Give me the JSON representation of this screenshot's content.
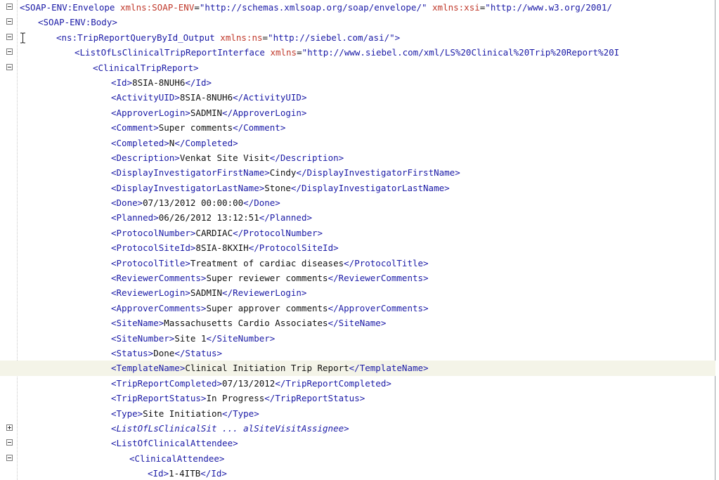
{
  "editor": {
    "lines": [
      {
        "indent": 0,
        "fold": "minus",
        "segs": [
          {
            "k": "tag",
            "t": "<SOAP-ENV:Envelope "
          },
          {
            "k": "attr",
            "t": "xmlns:SOAP-ENV"
          },
          {
            "k": "txt",
            "t": "="
          },
          {
            "k": "val",
            "t": "\"http://schemas.xmlsoap.org/soap/envelope/\" "
          },
          {
            "k": "attr",
            "t": "xmlns:xsi"
          },
          {
            "k": "txt",
            "t": "="
          },
          {
            "k": "val",
            "t": "\"http://www.w3.org/2001/"
          }
        ]
      },
      {
        "indent": 1,
        "fold": "minus",
        "segs": [
          {
            "k": "tag",
            "t": "<SOAP-ENV:Body>"
          }
        ]
      },
      {
        "indent": 2,
        "fold": "minus",
        "cursor": true,
        "segs": [
          {
            "k": "tag",
            "t": "<ns:TripReportQueryById_Output "
          },
          {
            "k": "attr",
            "t": "xmlns:ns"
          },
          {
            "k": "txt",
            "t": "="
          },
          {
            "k": "val",
            "t": "\"http://siebel.com/asi/\">"
          }
        ]
      },
      {
        "indent": 3,
        "fold": "minus",
        "segs": [
          {
            "k": "tag",
            "t": "<ListOfLsClinicalTripReportInterface "
          },
          {
            "k": "attr",
            "t": "xmlns"
          },
          {
            "k": "txt",
            "t": "="
          },
          {
            "k": "val",
            "t": "\"http://www.siebel.com/xml/LS%20Clinical%20Trip%20Report%20I"
          }
        ]
      },
      {
        "indent": 4,
        "fold": "minus",
        "segs": [
          {
            "k": "tag",
            "t": "<ClinicalTripReport>"
          }
        ]
      },
      {
        "indent": 5,
        "segs": [
          {
            "k": "tag",
            "t": "<Id>"
          },
          {
            "k": "txt",
            "t": "8SIA-8NUH6"
          },
          {
            "k": "tag",
            "t": "</Id>"
          }
        ]
      },
      {
        "indent": 5,
        "segs": [
          {
            "k": "tag",
            "t": "<ActivityUID>"
          },
          {
            "k": "txt",
            "t": "8SIA-8NUH6"
          },
          {
            "k": "tag",
            "t": "</ActivityUID>"
          }
        ]
      },
      {
        "indent": 5,
        "segs": [
          {
            "k": "tag",
            "t": "<ApproverLogin>"
          },
          {
            "k": "txt",
            "t": "SADMIN"
          },
          {
            "k": "tag",
            "t": "</ApproverLogin>"
          }
        ]
      },
      {
        "indent": 5,
        "segs": [
          {
            "k": "tag",
            "t": "<Comment>"
          },
          {
            "k": "txt",
            "t": "Super comments"
          },
          {
            "k": "tag",
            "t": "</Comment>"
          }
        ]
      },
      {
        "indent": 5,
        "segs": [
          {
            "k": "tag",
            "t": "<Completed>"
          },
          {
            "k": "txt",
            "t": "N"
          },
          {
            "k": "tag",
            "t": "</Completed>"
          }
        ]
      },
      {
        "indent": 5,
        "segs": [
          {
            "k": "tag",
            "t": "<Description>"
          },
          {
            "k": "txt",
            "t": "Venkat Site Visit"
          },
          {
            "k": "tag",
            "t": "</Description>"
          }
        ]
      },
      {
        "indent": 5,
        "segs": [
          {
            "k": "tag",
            "t": "<DisplayInvestigatorFirstName>"
          },
          {
            "k": "txt",
            "t": "Cindy"
          },
          {
            "k": "tag",
            "t": "</DisplayInvestigatorFirstName>"
          }
        ]
      },
      {
        "indent": 5,
        "segs": [
          {
            "k": "tag",
            "t": "<DisplayInvestigatorLastName>"
          },
          {
            "k": "txt",
            "t": "Stone"
          },
          {
            "k": "tag",
            "t": "</DisplayInvestigatorLastName>"
          }
        ]
      },
      {
        "indent": 5,
        "segs": [
          {
            "k": "tag",
            "t": "<Done>"
          },
          {
            "k": "txt",
            "t": "07/13/2012 00:00:00"
          },
          {
            "k": "tag",
            "t": "</Done>"
          }
        ]
      },
      {
        "indent": 5,
        "segs": [
          {
            "k": "tag",
            "t": "<Planned>"
          },
          {
            "k": "txt",
            "t": "06/26/2012 13:12:51"
          },
          {
            "k": "tag",
            "t": "</Planned>"
          }
        ]
      },
      {
        "indent": 5,
        "segs": [
          {
            "k": "tag",
            "t": "<ProtocolNumber>"
          },
          {
            "k": "txt",
            "t": "CARDIAC"
          },
          {
            "k": "tag",
            "t": "</ProtocolNumber>"
          }
        ]
      },
      {
        "indent": 5,
        "segs": [
          {
            "k": "tag",
            "t": "<ProtocolSiteId>"
          },
          {
            "k": "txt",
            "t": "8SIA-8KXIH"
          },
          {
            "k": "tag",
            "t": "</ProtocolSiteId>"
          }
        ]
      },
      {
        "indent": 5,
        "segs": [
          {
            "k": "tag",
            "t": "<ProtocolTitle>"
          },
          {
            "k": "txt",
            "t": "Treatment of cardiac diseases"
          },
          {
            "k": "tag",
            "t": "</ProtocolTitle>"
          }
        ]
      },
      {
        "indent": 5,
        "segs": [
          {
            "k": "tag",
            "t": "<ReviewerComments>"
          },
          {
            "k": "txt",
            "t": "Super reviewer comments"
          },
          {
            "k": "tag",
            "t": "</ReviewerComments>"
          }
        ]
      },
      {
        "indent": 5,
        "segs": [
          {
            "k": "tag",
            "t": "<ReviewerLogin>"
          },
          {
            "k": "txt",
            "t": "SADMIN"
          },
          {
            "k": "tag",
            "t": "</ReviewerLogin>"
          }
        ]
      },
      {
        "indent": 5,
        "segs": [
          {
            "k": "tag",
            "t": "<ApproverComments>"
          },
          {
            "k": "txt",
            "t": "Super approver comments"
          },
          {
            "k": "tag",
            "t": "</ApproverComments>"
          }
        ]
      },
      {
        "indent": 5,
        "segs": [
          {
            "k": "tag",
            "t": "<SiteName>"
          },
          {
            "k": "txt",
            "t": "Massachusetts Cardio Associates"
          },
          {
            "k": "tag",
            "t": "</SiteName>"
          }
        ]
      },
      {
        "indent": 5,
        "segs": [
          {
            "k": "tag",
            "t": "<SiteNumber>"
          },
          {
            "k": "txt",
            "t": "Site 1"
          },
          {
            "k": "tag",
            "t": "</SiteNumber>"
          }
        ]
      },
      {
        "indent": 5,
        "segs": [
          {
            "k": "tag",
            "t": "<Status>"
          },
          {
            "k": "txt",
            "t": "Done"
          },
          {
            "k": "tag",
            "t": "</Status>"
          }
        ]
      },
      {
        "indent": 5,
        "current": true,
        "segs": [
          {
            "k": "tag",
            "t": "<TemplateName>"
          },
          {
            "k": "txt",
            "t": "Clinical Initiation Trip Report"
          },
          {
            "k": "tag",
            "t": "</TemplateName>"
          }
        ]
      },
      {
        "indent": 5,
        "segs": [
          {
            "k": "tag",
            "t": "<TripReportCompleted>"
          },
          {
            "k": "txt",
            "t": "07/13/2012"
          },
          {
            "k": "tag",
            "t": "</TripReportCompleted>"
          }
        ]
      },
      {
        "indent": 5,
        "segs": [
          {
            "k": "tag",
            "t": "<TripReportStatus>"
          },
          {
            "k": "txt",
            "t": "In Progress"
          },
          {
            "k": "tag",
            "t": "</TripReportStatus>"
          }
        ]
      },
      {
        "indent": 5,
        "segs": [
          {
            "k": "tag",
            "t": "<Type>"
          },
          {
            "k": "txt",
            "t": "Site Initiation"
          },
          {
            "k": "tag",
            "t": "</Type>"
          }
        ]
      },
      {
        "indent": 5,
        "fold": "plus",
        "segs": [
          {
            "k": "collapsed",
            "t": "<ListOfLsClinicalSit ... alSiteVisitAssignee>"
          }
        ]
      },
      {
        "indent": 5,
        "fold": "minus",
        "segs": [
          {
            "k": "tag",
            "t": "<ListOfClinicalAttendee>"
          }
        ]
      },
      {
        "indent": 6,
        "fold": "minus",
        "segs": [
          {
            "k": "tag",
            "t": "<ClinicalAttendee>"
          }
        ]
      },
      {
        "indent": 7,
        "segs": [
          {
            "k": "tag",
            "t": "<Id>"
          },
          {
            "k": "txt",
            "t": "1-4ITB"
          },
          {
            "k": "tag",
            "t": "</Id>"
          }
        ]
      }
    ]
  }
}
